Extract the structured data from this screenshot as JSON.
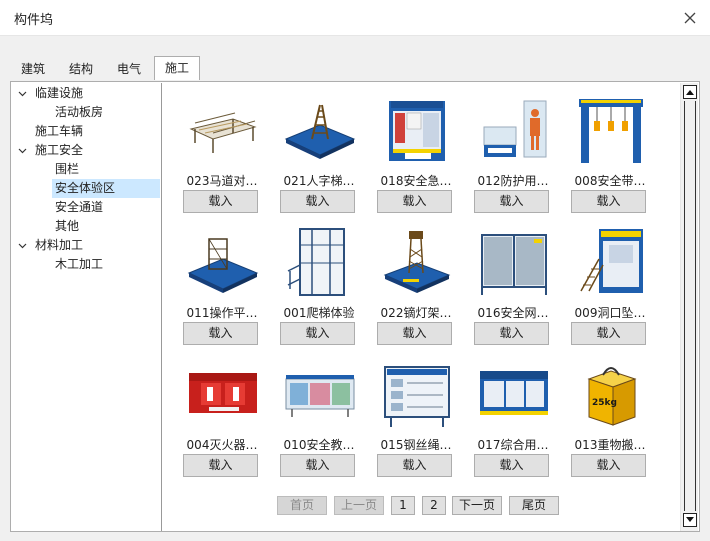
{
  "window": {
    "title": "构件坞",
    "close_icon": "close-icon"
  },
  "tabs": [
    "建筑",
    "结构",
    "电气",
    "施工"
  ],
  "active_tab": "施工",
  "tree": [
    {
      "label": "临建设施",
      "expanded": true,
      "level": 0
    },
    {
      "label": "活动板房",
      "level": 1
    },
    {
      "label": "施工车辆",
      "level": 0
    },
    {
      "label": "施工安全",
      "expanded": true,
      "level": 0
    },
    {
      "label": "围栏",
      "level": 1
    },
    {
      "label": "安全体验区",
      "level": 1,
      "selected": true
    },
    {
      "label": "安全通道",
      "level": 1
    },
    {
      "label": "其他",
      "level": 1
    },
    {
      "label": "材料加工",
      "expanded": true,
      "level": 0
    },
    {
      "label": "木工加工",
      "level": 1
    }
  ],
  "load_label": "载入",
  "items": [
    {
      "label": "023马道对…",
      "icon": "walkway-scaffold-icon"
    },
    {
      "label": "021人字梯…",
      "icon": "a-ladder-icon"
    },
    {
      "label": "018安全急…",
      "icon": "first-aid-booth-icon"
    },
    {
      "label": "012防护用…",
      "icon": "ppe-display-icon"
    },
    {
      "label": "008安全带…",
      "icon": "safety-belt-frame-icon"
    },
    {
      "label": "011操作平…",
      "icon": "operation-platform-icon"
    },
    {
      "label": "001爬梯体验",
      "icon": "climb-ladder-icon"
    },
    {
      "label": "022镝灯架…",
      "icon": "light-tower-icon"
    },
    {
      "label": "016安全网…",
      "icon": "safety-net-icon"
    },
    {
      "label": "009洞口坠…",
      "icon": "opening-fall-icon"
    },
    {
      "label": "004灭火器…",
      "icon": "fire-extinguisher-icon"
    },
    {
      "label": "010安全教…",
      "icon": "education-board-icon"
    },
    {
      "label": "015钢丝绳…",
      "icon": "wire-rope-board-icon"
    },
    {
      "label": "017综合用…",
      "icon": "electric-cabinet-icon"
    },
    {
      "label": "013重物搬…",
      "icon": "weight-box-icon"
    }
  ],
  "box_weight_text": "25kg",
  "pager": {
    "first": "首页",
    "prev": "上一页",
    "page1": "1",
    "page2": "2",
    "next": "下一页",
    "last": "尾页"
  },
  "colors": {
    "selection": "#cce8ff",
    "accent_blue": "#1f5fae"
  }
}
